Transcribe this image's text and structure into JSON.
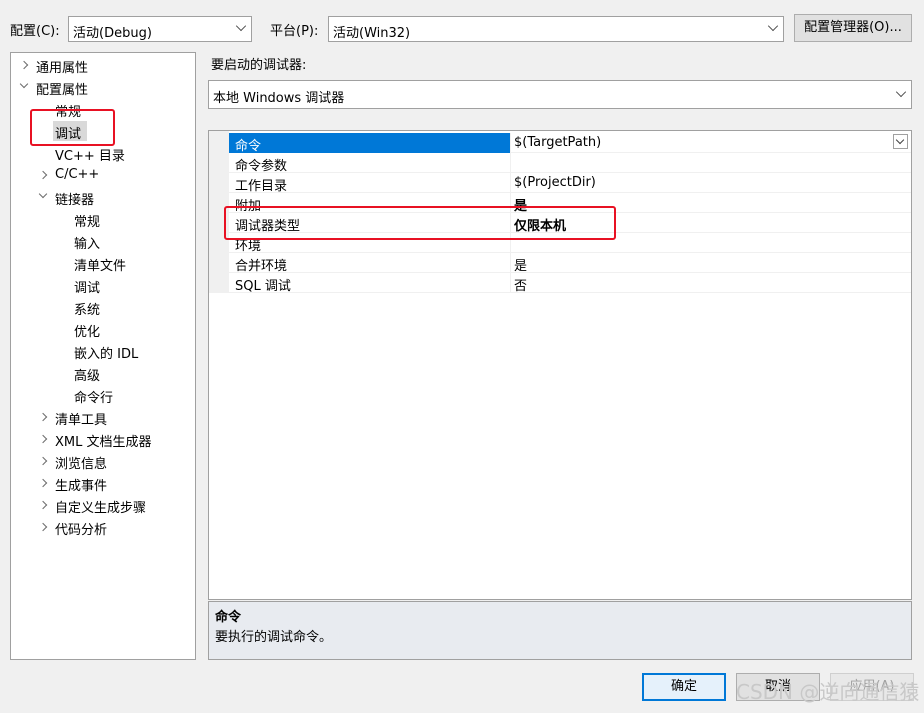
{
  "toolbar": {
    "config_label": "配置(C):",
    "config_value": "活动(Debug)",
    "platform_label": "平台(P):",
    "platform_value": "活动(Win32)",
    "config_manager_button": "配置管理器(O)..."
  },
  "tree": {
    "items": [
      {
        "label": "通用属性",
        "expander": "collapsed"
      },
      {
        "label": "配置属性",
        "expander": "expanded"
      },
      {
        "label": "常规"
      },
      {
        "label": "调试",
        "selected": true
      },
      {
        "label": "VC++ 目录"
      },
      {
        "label": "C/C++",
        "expander": "collapsed"
      },
      {
        "label": "链接器",
        "expander": "expanded"
      },
      {
        "label": "常规"
      },
      {
        "label": "输入"
      },
      {
        "label": "清单文件"
      },
      {
        "label": "调试"
      },
      {
        "label": "系统"
      },
      {
        "label": "优化"
      },
      {
        "label": "嵌入的 IDL"
      },
      {
        "label": "高级"
      },
      {
        "label": "命令行"
      },
      {
        "label": "清单工具",
        "expander": "collapsed"
      },
      {
        "label": "XML 文档生成器",
        "expander": "collapsed"
      },
      {
        "label": "浏览信息",
        "expander": "collapsed"
      },
      {
        "label": "生成事件",
        "expander": "collapsed"
      },
      {
        "label": "自定义生成步骤",
        "expander": "collapsed"
      },
      {
        "label": "代码分析",
        "expander": "collapsed"
      }
    ]
  },
  "debugger": {
    "label": "要启动的调试器:",
    "value": "本地 Windows 调试器"
  },
  "grid": {
    "rows": [
      {
        "name": "命令",
        "value": "$(TargetPath)"
      },
      {
        "name": "命令参数",
        "value": ""
      },
      {
        "name": "工作目录",
        "value": "$(ProjectDir)"
      },
      {
        "name": "附加",
        "value": "是"
      },
      {
        "name": "调试器类型",
        "value": "仅限本机"
      },
      {
        "name": "环境",
        "value": ""
      },
      {
        "name": "合并环境",
        "value": "是"
      },
      {
        "name": "SQL 调试",
        "value": "否"
      }
    ]
  },
  "description": {
    "title": "命令",
    "text": "要执行的调试命令。"
  },
  "buttons": {
    "ok": "确定",
    "cancel": "取消",
    "apply": "应用(A)"
  },
  "watermark": "CSDN @逆向通信猿",
  "colors": {
    "selection_blue": "#0078d7",
    "highlight_red": "#e81123"
  }
}
